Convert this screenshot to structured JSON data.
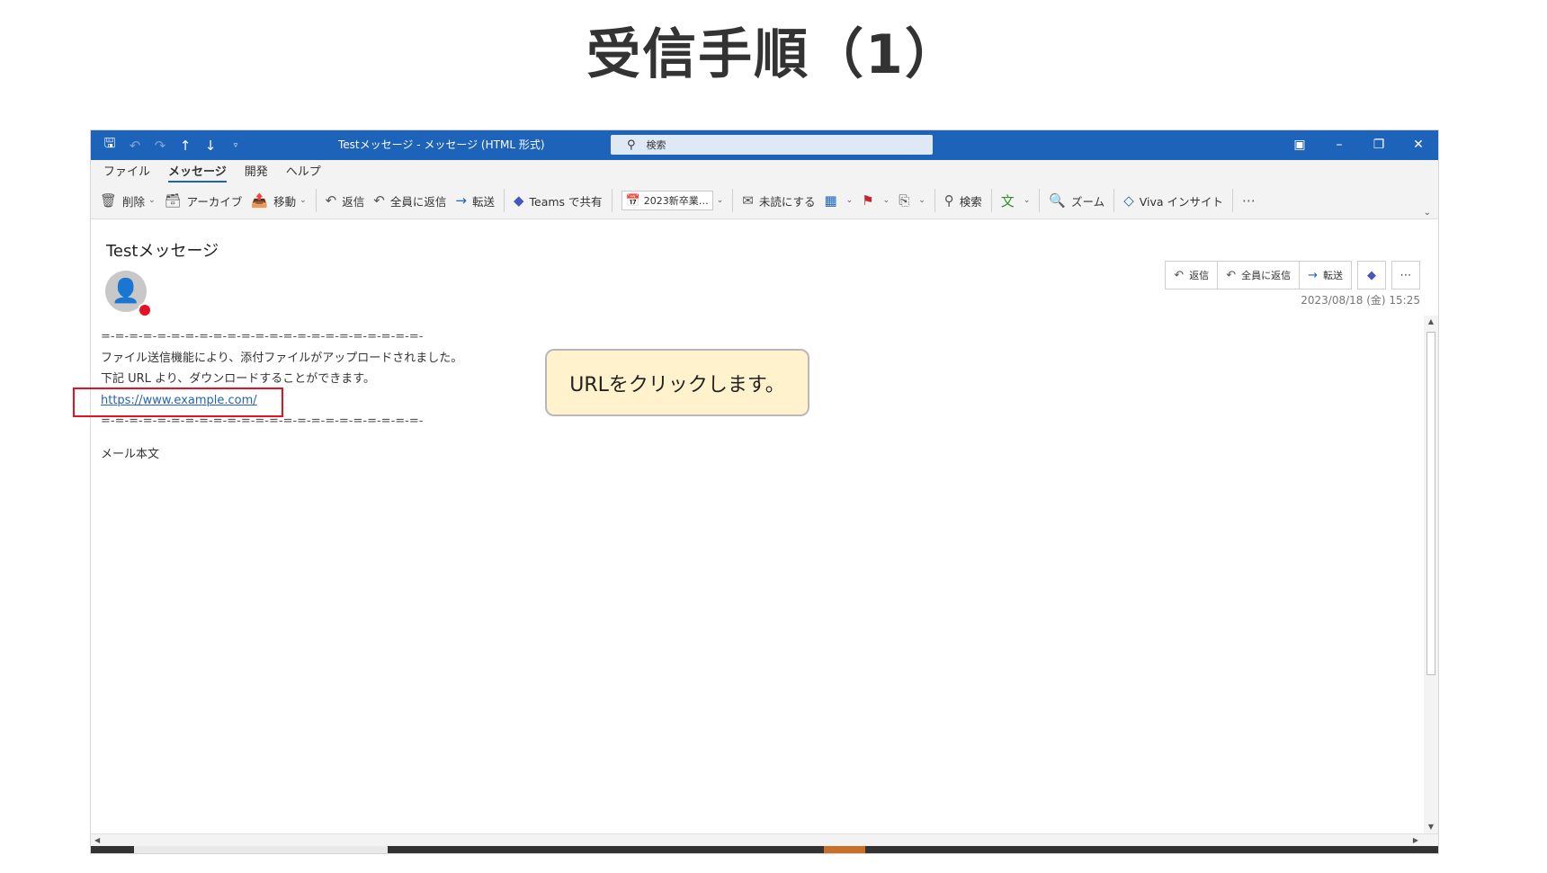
{
  "slide": {
    "title": "受信手順（1）"
  },
  "window": {
    "title": "Testメッセージ  -  メッセージ (HTML 形式)",
    "search_placeholder": "検索"
  },
  "menu": {
    "items": [
      "ファイル",
      "メッセージ",
      "開発",
      "ヘルプ"
    ],
    "active": "メッセージ"
  },
  "ribbon": {
    "delete": "削除",
    "archive": "アーカイブ",
    "move": "移動",
    "reply": "返信",
    "reply_all": "全員に返信",
    "forward": "転送",
    "teams_share": "Teams で共有",
    "calendar": "2023新卒業…",
    "mark_unread": "未読にする",
    "search": "検索",
    "zoom": "ズーム",
    "viva": "Viva インサイト"
  },
  "message": {
    "subject": "Testメッセージ",
    "actions": {
      "reply": "返信",
      "reply_all": "全員に返信",
      "forward": "転送"
    },
    "date": "2023/08/18 (金) 15:25",
    "divider": "=-=-=-=-=-=-=-=-=-=-=-=-=-=-=-=-=-=-=-=-=-=-=-",
    "line1": "ファイル送信機能により、添付ファイルがアップロードされました。",
    "line2": "下記 URL より、ダウンロードすることができます。",
    "url": "https://www.example.com/",
    "body_label": "メール本文"
  },
  "callout": {
    "text": "URLをクリックします。"
  },
  "colors": {
    "titlebar": "#1c63b9",
    "highlight": "#e8111f",
    "callout_bg": "#fff2cc",
    "link": "#2563b8"
  }
}
